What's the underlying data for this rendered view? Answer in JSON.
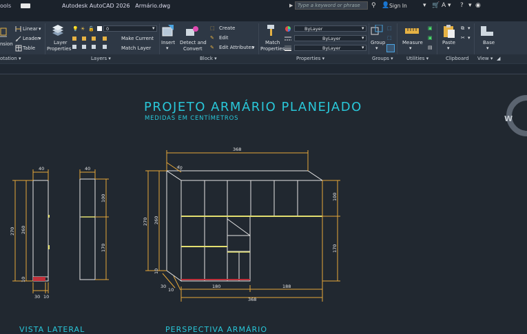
{
  "titlebar": {
    "left_label": "ools",
    "app_title": "Autodesk AutoCAD 2026",
    "file_name": "Armário.dwg",
    "search_placeholder": "Type a keyword or phrase",
    "sign_in": "Sign In"
  },
  "ribbon": {
    "annotation": {
      "linear": "Linear",
      "leader": "Leader",
      "table": "Table",
      "partial": "nsion"
    },
    "layers": {
      "layer_properties": [
        "Layer",
        "Properties"
      ],
      "layer_value": "0",
      "make_current": "Make Current",
      "match_layer": "Match Layer"
    },
    "block": {
      "insert": "Insert",
      "detect_convert": [
        "Detect and",
        "Convert"
      ],
      "create": "Create",
      "edit": "Edit",
      "edit_attributes": "Edit Attributes"
    },
    "properties": {
      "match_properties": [
        "Match",
        "Properties"
      ],
      "color": "ByLayer",
      "linetype": "ByLayer",
      "lineweight": "ByLayer"
    },
    "groups": {
      "group": "Group"
    },
    "utilities": {
      "measure": "Measure"
    },
    "clipboard": {
      "paste": "Paste"
    },
    "view": {
      "base": "Base"
    }
  },
  "panels": {
    "annotation": "otation ▾",
    "layers": "Layers ▾",
    "block": "Block ▾",
    "properties": "Properties ▾",
    "groups": "Groups ▾",
    "utilities": "Utilities ▾",
    "clipboard": "Clipboard",
    "view": "View ▾"
  },
  "drawing": {
    "title": "PROJETO ARMÁRIO PLANEJADO",
    "subtitle": "MEDIDAS EM CENTÍMETROS",
    "label_lateral": "VISTA LATERAL",
    "label_perspectiva": "PERSPECTIVA ARMÁRIO",
    "viewcube_letter": "W",
    "dims": {
      "d40a": "40",
      "d40b": "40",
      "d270a": "270",
      "d260": "260",
      "d30": "30",
      "d10a": "10",
      "d100a": "100",
      "d170a": "170",
      "d368top": "368",
      "d40c": "40",
      "d270b": "270",
      "d260b": "260",
      "d10b": "10",
      "d100b": "100",
      "d170b": "170",
      "d180": "180",
      "d188": "188",
      "d368bot": "368",
      "d30b": "30",
      "d10c": "10"
    }
  },
  "colors": {
    "accent_cyan": "#29c7d9",
    "dim_orange": "#e8a93a",
    "cad_white": "#e6e6e6",
    "shelf_yellow": "#e4e070",
    "base_red": "#c0303a"
  }
}
